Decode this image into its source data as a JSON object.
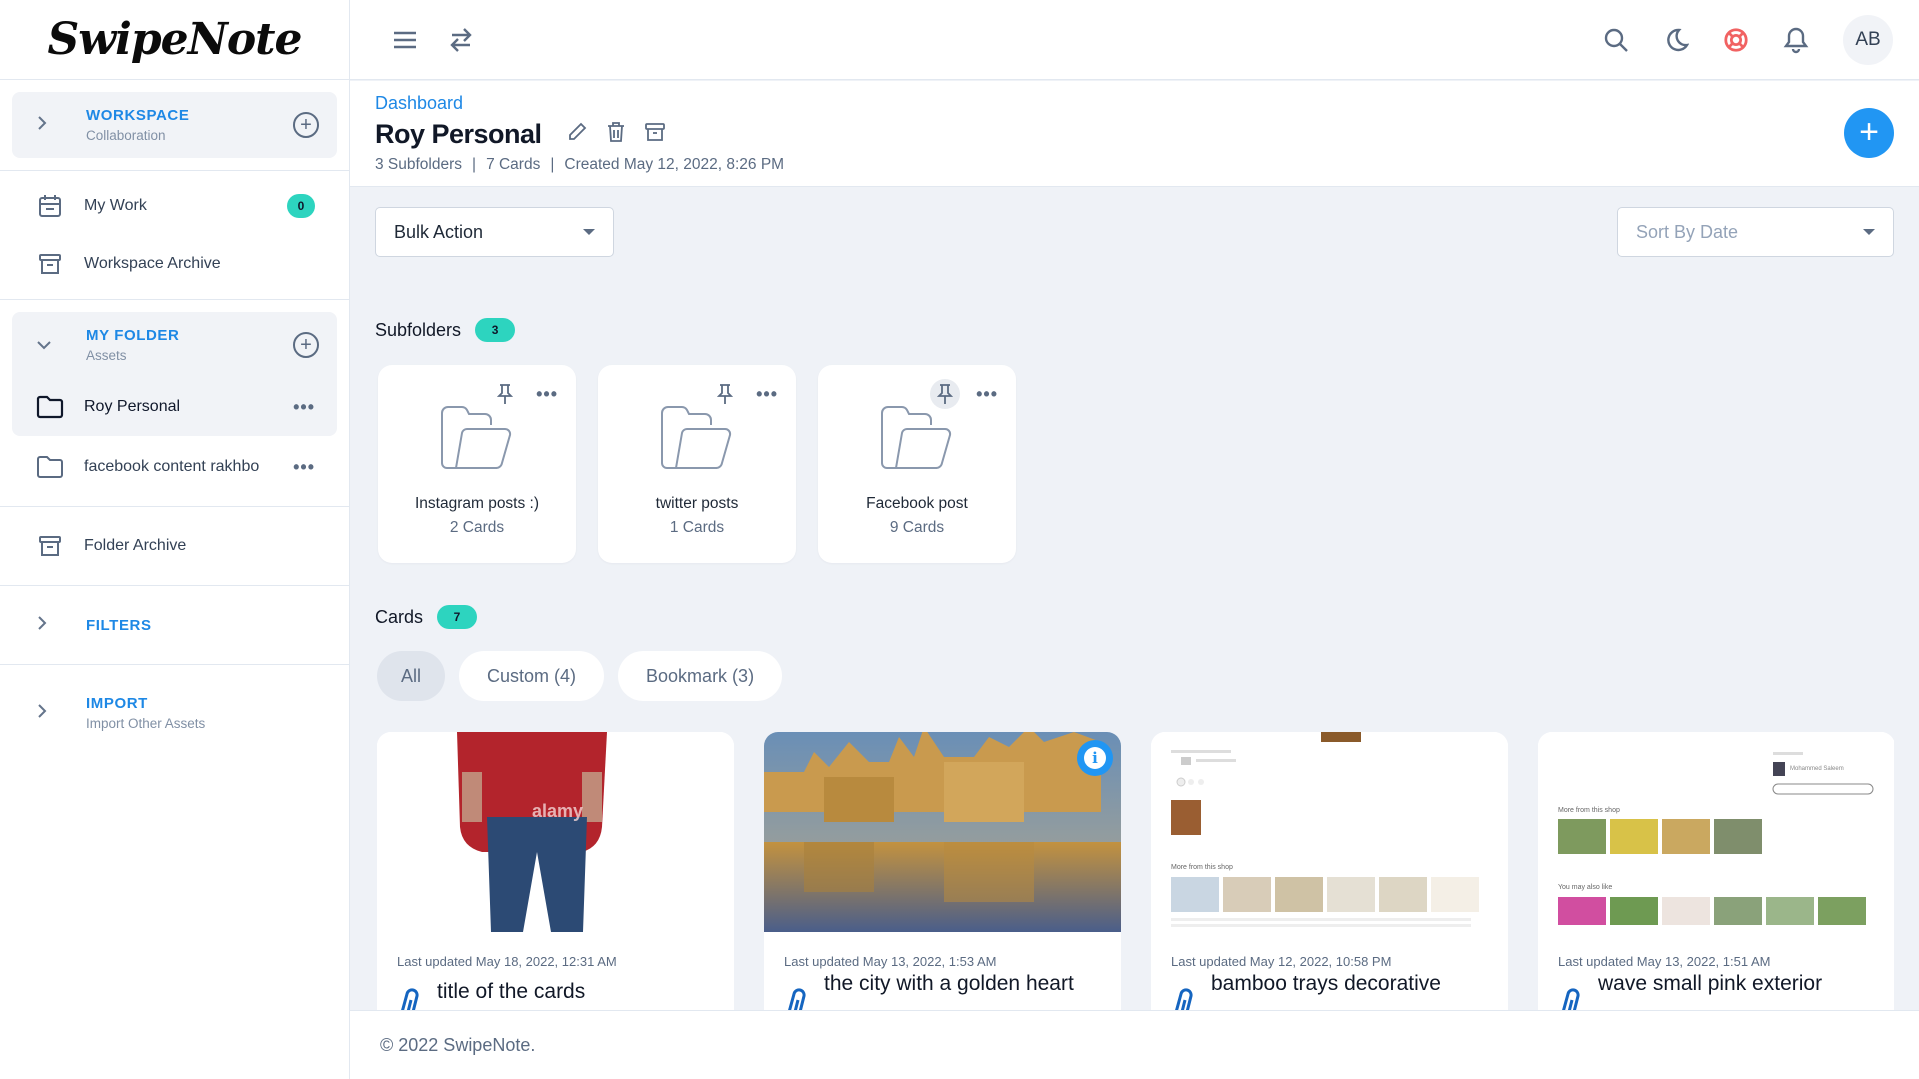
{
  "app": {
    "logo_text": "SwipeNote"
  },
  "colors": {
    "accent": "#1e88e5",
    "fab": "#2196f3",
    "badge": "#2dd4bf",
    "help_icon": "#f16262",
    "background": "#eff2f7"
  },
  "sidebar": {
    "workspace": {
      "title": "WORKSPACE",
      "subtitle": "Collaboration",
      "icon": "chevron-right-icon",
      "add_icon": "add-circle-icon"
    },
    "items": [
      {
        "label": "My Work",
        "icon": "calendar-icon",
        "badge": "0"
      },
      {
        "label": "Workspace Archive",
        "icon": "archive-icon"
      }
    ],
    "my_folder": {
      "title": "MY FOLDER",
      "subtitle": "Assets",
      "icon": "chevron-down-icon",
      "add_icon": "add-circle-icon",
      "folders": [
        {
          "label": "Roy Personal",
          "active": true,
          "more": "•••"
        },
        {
          "label": "facebook content rakhbo",
          "active": false,
          "more": "•••"
        }
      ]
    },
    "folder_archive": {
      "label": "Folder Archive",
      "icon": "archive-icon"
    },
    "filters": {
      "title": "FILTERS"
    },
    "import": {
      "title": "IMPORT",
      "subtitle": "Import Other Assets"
    }
  },
  "topbar": {
    "left_icons": [
      "menu-icon",
      "swap-icon"
    ],
    "right_icons": [
      "search-icon",
      "moon-icon",
      "help-lifebuoy-icon",
      "bell-icon"
    ],
    "avatar_initials": "AB"
  },
  "page": {
    "breadcrumb": "Dashboard",
    "title": "Roy Personal",
    "meta": {
      "subfolders": "3 Subfolders",
      "cards": "7 Cards",
      "created": "Created May 12, 2022, 8:26 PM",
      "separator": "|"
    },
    "fab_label": "+"
  },
  "controls": {
    "bulk_action": "Bulk Action",
    "sort_placeholder": "Sort By Date"
  },
  "subfolders": {
    "label": "Subfolders",
    "count": "3",
    "items": [
      {
        "name": "Instagram posts :)",
        "count": "2 Cards"
      },
      {
        "name": "twitter posts",
        "count": "1 Cards"
      },
      {
        "name": "Facebook post",
        "count": "9 Cards"
      }
    ]
  },
  "cards_section": {
    "label": "Cards",
    "count": "7",
    "tabs": [
      {
        "label": "All",
        "active": true
      },
      {
        "label": "Custom (4)",
        "active": false
      },
      {
        "label": "Bookmark (3)",
        "active": false
      }
    ],
    "items": [
      {
        "updated": "Last updated May 18, 2022, 12:31 AM",
        "title": "title of the cards",
        "image": "person-red-sweater-photo",
        "watermark": "alamy"
      },
      {
        "updated": "Last updated May 13, 2022, 1:53 AM",
        "title": "the city with a golden heart",
        "image": "golden-city-lake-photo",
        "info": true
      },
      {
        "updated": "Last updated May 12, 2022, 10:58 PM",
        "title": "bamboo trays decorative",
        "image": "shop-page-screenshot",
        "shop_label": "More from this shop"
      },
      {
        "updated": "Last updated May 13, 2022, 1:51 AM",
        "title": "wave small pink exterior",
        "image": "plant-shop-screenshot",
        "shop_label": "More from this shop",
        "also_like": "You may also like",
        "seller": "Mohammed Saleem"
      }
    ]
  },
  "footer": {
    "text": "© 2022 SwipeNote."
  }
}
